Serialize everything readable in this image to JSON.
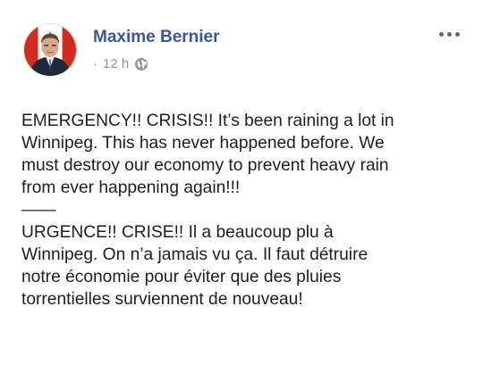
{
  "post": {
    "author": "Maxime Bernier",
    "meta": {
      "separator": "·",
      "time": "12 h",
      "audience_icon": "globe-icon"
    },
    "more_icon": "more-options-icon",
    "text": {
      "english": "EMERGENCY!! CRISIS!! It’s been raining a lot in\nWinnipeg. This has never happened before. We\nmust destroy our economy to prevent heavy rain\nfrom ever happening again!!!",
      "divider": "——",
      "french": "URGENCE!! CRISE!! Il a beaucoup plu à\nWinnipeg. On n’a jamais vu ça. Il faut détruire\nnotre économie pour éviter que des pluies\ntorrentielles surviennent de nouveau!"
    }
  },
  "colors": {
    "author_link": "#385898",
    "meta_text": "#90949c",
    "body_text": "#1c1e21",
    "avatar_bg": "#c8102e"
  }
}
